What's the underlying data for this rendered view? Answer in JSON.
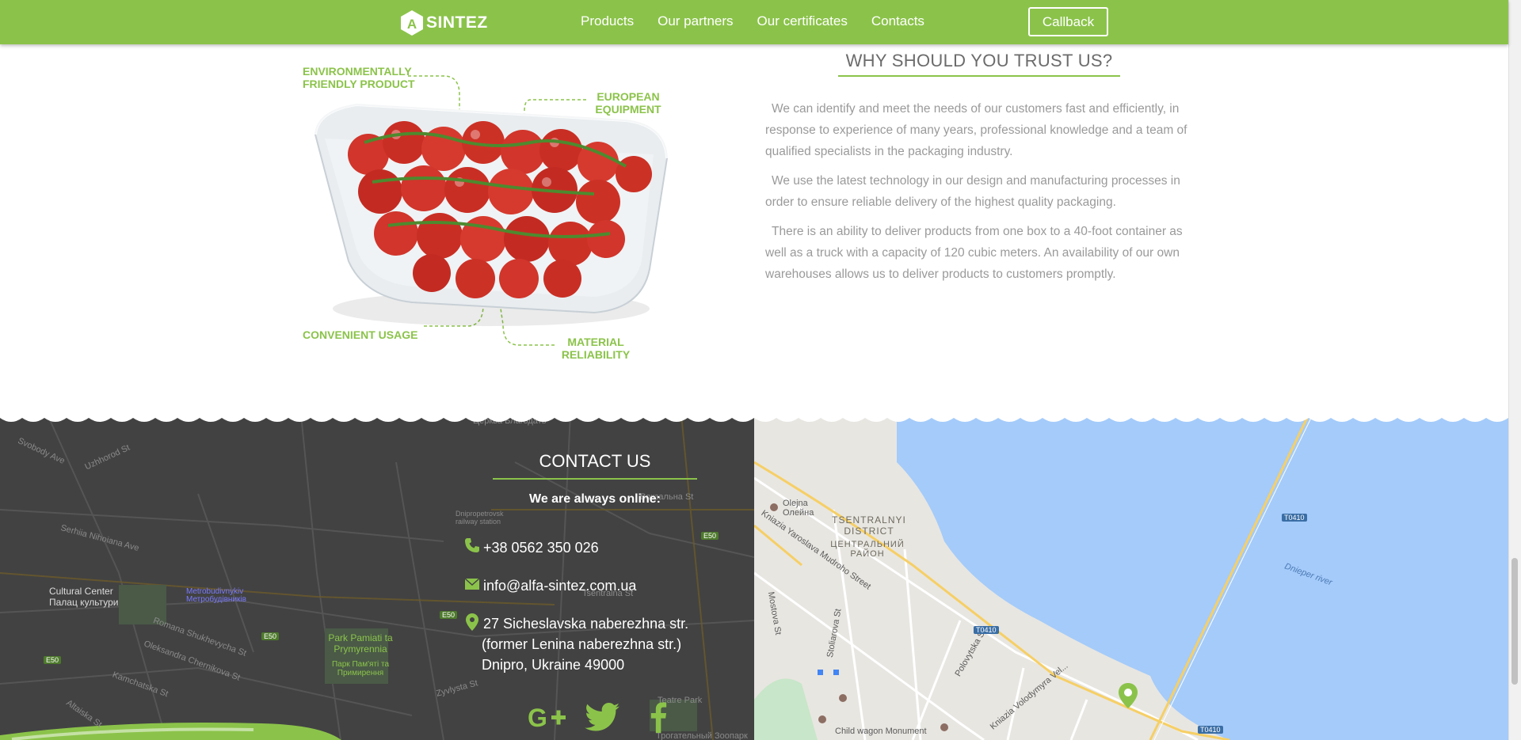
{
  "header": {
    "logo_letter": "A",
    "logo_text": "SINTEZ",
    "nav": [
      "Products",
      "Our partners",
      "Our certificates",
      "Contacts"
    ],
    "callback_label": "Callback"
  },
  "trust": {
    "features": {
      "eco": "ENVIRONMENTALLY\nFRIENDLY PRODUCT",
      "euro": "EUROPEAN\nEQUIPMENT",
      "usage": "CONVENIENT USAGE",
      "reliability": "MATERIAL\nRELIABILITY"
    },
    "title": "WHY SHOULD YOU TRUST US?",
    "paragraphs": [
      "We can identify and meet the needs of our customers fast and efficiently, in response to experience of many years, professional knowledge and a team of qualified specialists in the packaging industry.",
      "We use the latest technology in our design and manufacturing processes in order to ensure reliable delivery of the highest quality packaging.",
      "There is an ability to deliver products from one box to a 40-foot container as well as a truck with a capacity of 120 cubic meters. An availability of our own warehouses allows us to deliver products to customers promptly."
    ]
  },
  "contact": {
    "title": "CONTACT US",
    "online": "We are always online:",
    "phone": "+38 0562 350 026",
    "email": "info@alfa-sintez.com.ua",
    "address_1": "27 Sicheslavska naberezhna str.",
    "address_2": "(former Lenina naberezhna str.)",
    "address_3": "Dnipro, Ukraine 49000"
  },
  "map_dark": {
    "labels": [
      "Церква Благодать",
      "Svobody Ave",
      "Uzhhorod St",
      "Dnipropetrovsk railway station",
      "Вокзальна St",
      "Serhiia Nihoiana Ave",
      "Cultural Center",
      "Палац культури",
      "Metrobudivnykiv",
      "Метробудівників",
      "Romana Shukhevycha St",
      "Oleksandra Chernikova St",
      "Kamchatska St",
      "Altaiska St",
      "Park Pamiati ta Prymyrennia",
      "Парк Пам'яті та Примирення",
      "Zyvlysta St",
      "Tsentralna St",
      "Teatre Park",
      "Трогательный Зоопарк"
    ],
    "road_badges": [
      "E50",
      "E50",
      "E50",
      "E50"
    ]
  },
  "map_light": {
    "labels": [
      "Olejna",
      "Олейна",
      "TSENTRALNYI DISTRICT",
      "ЦЕНТРАЛЬНИЙ РАЙОН",
      "Kniazia Yaroslava Mudroho Street",
      "Mostova St",
      "Stoliarova St",
      "Polovytska St",
      "Kniazia Volodymyra Vel...",
      "Dnieper river",
      "Child wagon Monument"
    ],
    "road_badges": [
      "T0410",
      "T0410",
      "T0410"
    ],
    "water_color": "#a4cbfa",
    "marker_color": "#8bc34a"
  },
  "colors": {
    "brand": "#8bc34a",
    "dark_map": "#424242",
    "text_muted": "#9a9a9a"
  }
}
